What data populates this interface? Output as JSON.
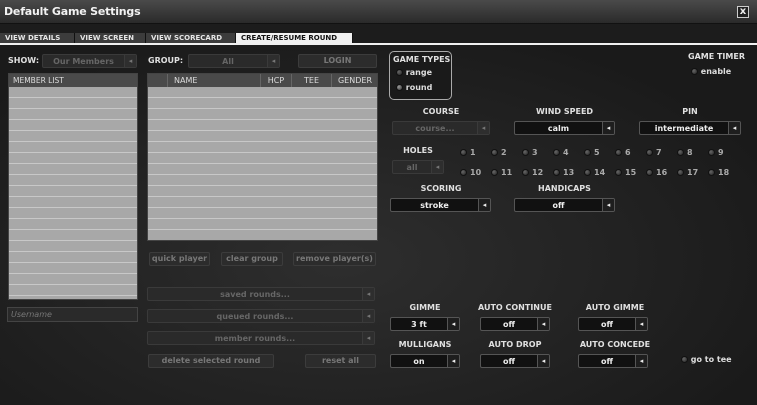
{
  "window": {
    "title": "Default Game Settings",
    "close_glyph": "x"
  },
  "tabs": [
    "VIEW DETAILS",
    "VIEW SCREEN",
    "VIEW SCORECARD",
    "CREATE/RESUME ROUND"
  ],
  "show": {
    "label": "SHOW:",
    "value": "Our Members"
  },
  "group": {
    "label": "GROUP:",
    "value": "All"
  },
  "login_label": "LOGIN",
  "member_list": {
    "header": "MEMBER LIST"
  },
  "group_table": {
    "columns": [
      "NAME",
      "HCP",
      "TEE",
      "GENDER"
    ]
  },
  "buttons": {
    "quick_player": "quick player",
    "clear_group": "clear group",
    "remove_players": "remove player(s)",
    "delete_round": "delete selected round",
    "reset_all": "reset all"
  },
  "rounds": {
    "saved": "saved rounds...",
    "queued": "queued rounds...",
    "member": "member rounds..."
  },
  "username_placeholder": "Username",
  "game_types": {
    "label": "GAME TYPES",
    "range": "range",
    "round": "round"
  },
  "game_timer": {
    "label": "GAME TIMER",
    "enable": "enable"
  },
  "course": {
    "label": "COURSE",
    "value": "course..."
  },
  "wind": {
    "label": "WIND SPEED",
    "value": "calm"
  },
  "pin": {
    "label": "PIN",
    "value": "intermediate"
  },
  "holes": {
    "label": "HOLES",
    "value": "all",
    "numbers": [
      "1",
      "2",
      "3",
      "4",
      "5",
      "6",
      "7",
      "8",
      "9",
      "10",
      "11",
      "12",
      "13",
      "14",
      "15",
      "16",
      "17",
      "18"
    ]
  },
  "scoring": {
    "label": "SCORING",
    "value": "stroke"
  },
  "handicaps": {
    "label": "HANDICAPS",
    "value": "off"
  },
  "gimme": {
    "label": "GIMME",
    "value": "3 ft"
  },
  "auto_continue": {
    "label": "AUTO CONTINUE",
    "value": "off"
  },
  "auto_gimme": {
    "label": "AUTO GIMME",
    "value": "off"
  },
  "mulligans": {
    "label": "MULLIGANS",
    "value": "on"
  },
  "auto_drop": {
    "label": "AUTO DROP",
    "value": "off"
  },
  "auto_concede": {
    "label": "AUTO CONCEDE",
    "value": "off"
  },
  "go_to_tee": "go to tee",
  "arrow_glyph": "◂"
}
